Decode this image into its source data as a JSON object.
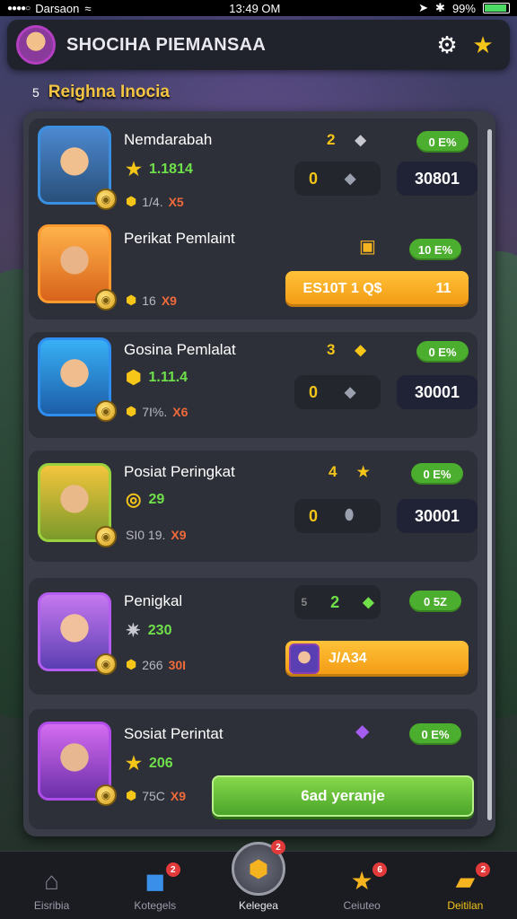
{
  "status_bar": {
    "carrier": "Darsaon",
    "time": "13:49 OM",
    "battery": "99%",
    "signal_icon": "wifi-icon"
  },
  "header": {
    "title": "SHOCIHA PIEMANSAA",
    "settings_icon": "gear-icon",
    "favorite_icon": "star-icon"
  },
  "subbar": {
    "prefix": "5",
    "title": "Reighna Inocia"
  },
  "cards": [
    {
      "name": "Nemdarabah",
      "stat_main": "1.1814",
      "stat_pre": "1/4.",
      "stat_val": "X5",
      "rank": "2",
      "pill": "0 E%",
      "box_left": "0",
      "box_right": "30801"
    },
    {
      "name": "Perikat Pemlaint",
      "stat_pre": "16",
      "stat_val": "X9",
      "pill": "10 E%",
      "button_left": "ES10T 1 Q$",
      "button_right": "11"
    },
    {
      "name": "Gosina Pemlalat",
      "stat_main": "1.11.4",
      "stat_pre": "7I%.",
      "stat_val": "X6",
      "rank": "3",
      "pill": "0 E%",
      "box_left": "0",
      "box_right": "30001"
    },
    {
      "name": "Posiat Peringkat",
      "stat_main": "29",
      "stat_pre": "SI0 19.",
      "stat_val": "X9",
      "rank": "4",
      "pill": "0 E%",
      "box_left": "0",
      "box_right": "30001"
    },
    {
      "name": "Penigkal",
      "stat_main": "230",
      "stat_pre": "266",
      "stat_val": "30I",
      "rank_prefix": "5",
      "rank": "2",
      "pill": "0 5Z",
      "button_text": "J/A34"
    },
    {
      "name": "Sosiat Perintat",
      "stat_main": "206",
      "stat_pre": "75C",
      "stat_val": "X9",
      "pill": "0 E%",
      "button_text": "6ad yeranje"
    }
  ],
  "bottom_nav": [
    {
      "label": "Eisribia",
      "icon": "home-icon",
      "badge": ""
    },
    {
      "label": "Kotegels",
      "icon": "cube-icon",
      "badge": "2"
    },
    {
      "label": "Kelegea",
      "icon": "shield-icon",
      "badge": "2"
    },
    {
      "label": "Ceiuteo",
      "icon": "star-icon",
      "badge": "6"
    },
    {
      "label": "Deitilan",
      "icon": "chart-icon",
      "badge": "2"
    }
  ]
}
